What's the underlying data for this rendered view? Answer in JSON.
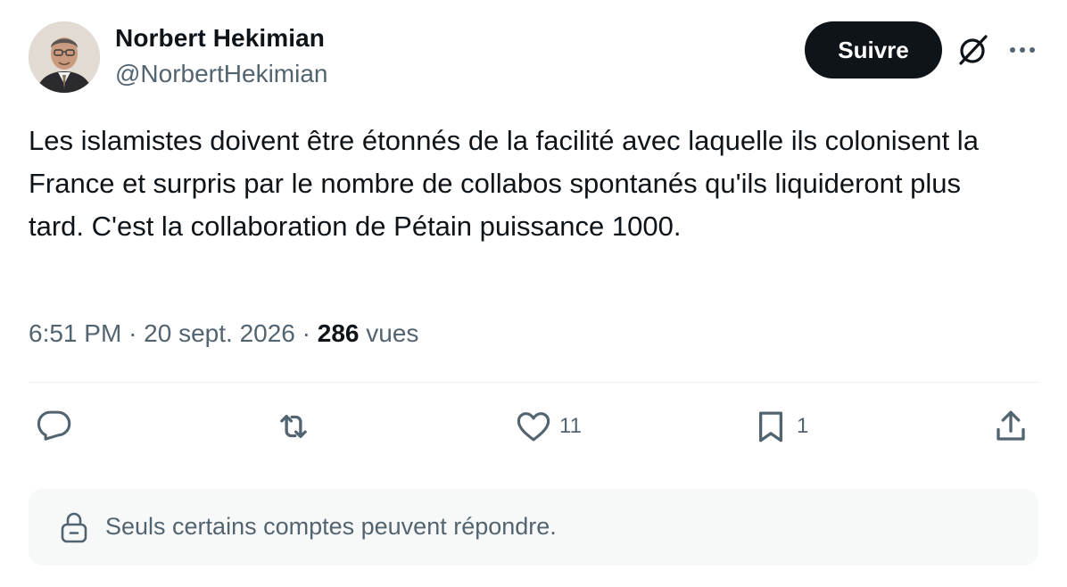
{
  "author": {
    "name": "Norbert Hekimian",
    "handle": "@NorbertHekimian"
  },
  "follow_button": {
    "label": "Suivre"
  },
  "tweet": {
    "text": "Les islamistes doivent être étonnés de la facilité avec laquelle ils colonisent la France et surpris par le nombre de collabos spontanés qu'ils liquideront plus tard. C'est la collaboration de Pétain puissance 1000.",
    "time": "6:51 PM",
    "date": "20 sept. 2026",
    "views_count": "286",
    "views_label": "vues",
    "separator": "·"
  },
  "actions": {
    "reply": {
      "icon": "reply-icon",
      "count": ""
    },
    "retweet": {
      "icon": "retweet-icon",
      "count": ""
    },
    "like": {
      "icon": "heart-icon",
      "count": "11"
    },
    "bookmark": {
      "icon": "bookmark-icon",
      "count": "1"
    },
    "share": {
      "icon": "share-icon"
    }
  },
  "reply_restriction": {
    "icon": "lock-icon",
    "text": "Seuls certains comptes peuvent répondre."
  },
  "colors": {
    "text_primary": "#0f1419",
    "text_secondary": "#536471",
    "divider": "#eff3f4",
    "notice_background": "#f7f9f9",
    "follow_button_background": "#0f1419"
  }
}
